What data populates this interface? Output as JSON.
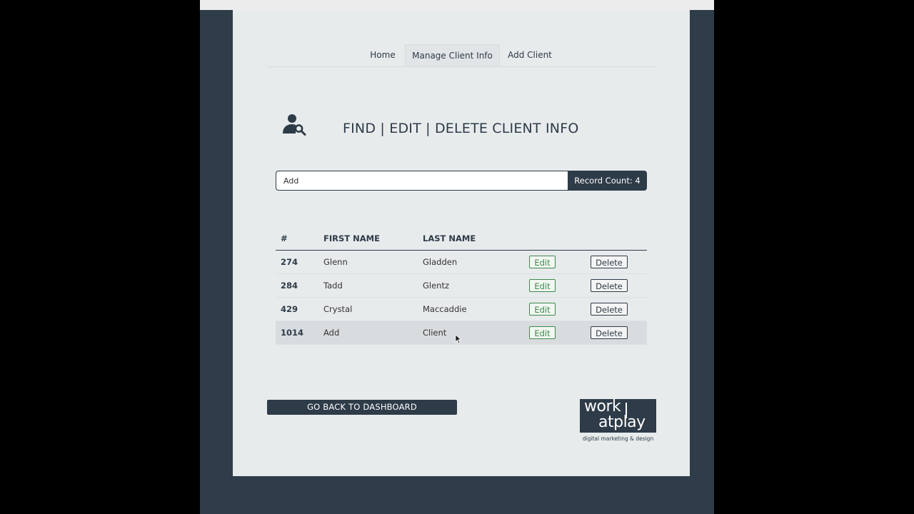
{
  "nav": {
    "tabs": [
      {
        "label": "Home"
      },
      {
        "label": "Manage Client Info",
        "active": true
      },
      {
        "label": "Add Client"
      }
    ]
  },
  "header": {
    "title": "FIND | EDIT | DELETE CLIENT INFO",
    "icon": "person-search-icon"
  },
  "search": {
    "value": "Add",
    "record_count_label": "Record Count: 4"
  },
  "table": {
    "columns": [
      "#",
      "FIRST NAME",
      "LAST NAME"
    ],
    "rows": [
      {
        "id": "274",
        "first": "Glenn",
        "last": "Gladden",
        "edit": "Edit",
        "delete": "Delete"
      },
      {
        "id": "284",
        "first": "Tadd",
        "last": "Glentz",
        "edit": "Edit",
        "delete": "Delete"
      },
      {
        "id": "429",
        "first": "Crystal",
        "last": "Maccaddie",
        "edit": "Edit",
        "delete": "Delete"
      },
      {
        "id": "1014",
        "first": "Add",
        "last": "Client",
        "edit": "Edit",
        "delete": "Delete",
        "hovered": true
      }
    ]
  },
  "footer": {
    "back_label": "GO BACK TO DASHBOARD",
    "logo_line1": "work",
    "logo_line2": "atplay",
    "logo_tagline": "digital marketing & design"
  },
  "colors": {
    "page_background": "#2f3c4a",
    "panel": "#e7ebec",
    "accent_dark": "#2e3b48",
    "edit_green": "#3b8a4c"
  }
}
